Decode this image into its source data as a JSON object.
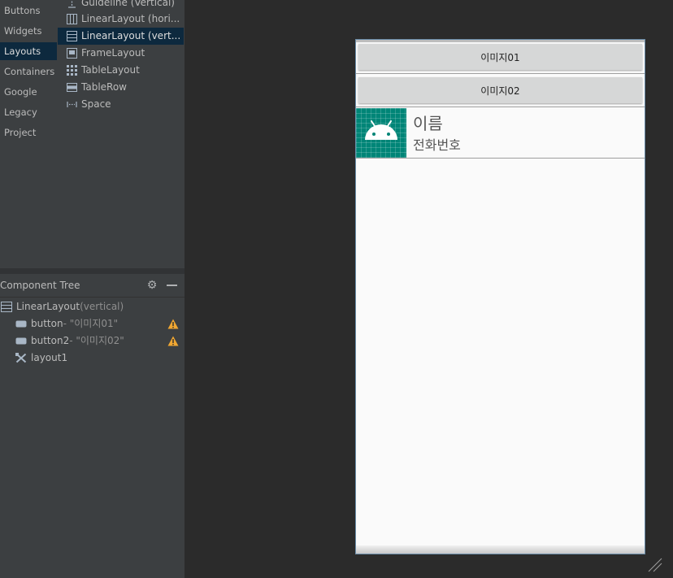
{
  "palette": {
    "categories": [
      {
        "label": "Buttons",
        "selected": false
      },
      {
        "label": "Widgets",
        "selected": false
      },
      {
        "label": "Layouts",
        "selected": true
      },
      {
        "label": "Containers",
        "selected": false
      },
      {
        "label": "Google",
        "selected": false
      },
      {
        "label": "Legacy",
        "selected": false
      },
      {
        "label": "Project",
        "selected": false
      }
    ],
    "items": [
      {
        "label": "Guideline (Vertical)",
        "icon": "guideline-vertical-icon"
      },
      {
        "label": "LinearLayout (hori...",
        "icon": "linearlayout-horizontal-icon"
      },
      {
        "label": "LinearLayout (vert...",
        "icon": "linearlayout-vertical-icon",
        "selected": true
      },
      {
        "label": "FrameLayout",
        "icon": "framelayout-icon"
      },
      {
        "label": "TableLayout",
        "icon": "tablelayout-icon"
      },
      {
        "label": "TableRow",
        "icon": "tablerow-icon"
      },
      {
        "label": "Space",
        "icon": "space-icon"
      }
    ]
  },
  "component_tree": {
    "title": "Component Tree",
    "root": {
      "name": "LinearLayout",
      "sub": "(vertical)",
      "icon": "linearlayout-vertical-icon"
    },
    "children": [
      {
        "name": "button",
        "sub": "- \"이미지01\"",
        "icon": "button-icon",
        "warning": true
      },
      {
        "name": "button2",
        "sub": "- \"이미지02\"",
        "icon": "button-icon",
        "warning": true
      },
      {
        "name": "layout1",
        "sub": "",
        "icon": "include-tools-icon",
        "warning": false
      }
    ]
  },
  "preview": {
    "button1": "이미지01",
    "button2": "이미지02",
    "item": {
      "name": "이름",
      "phone": "전화번호",
      "icon": "android-icon"
    }
  },
  "colors": {
    "accent_selected": "#0d293e",
    "warning": "#f0a732",
    "android_teal": "#008577"
  }
}
